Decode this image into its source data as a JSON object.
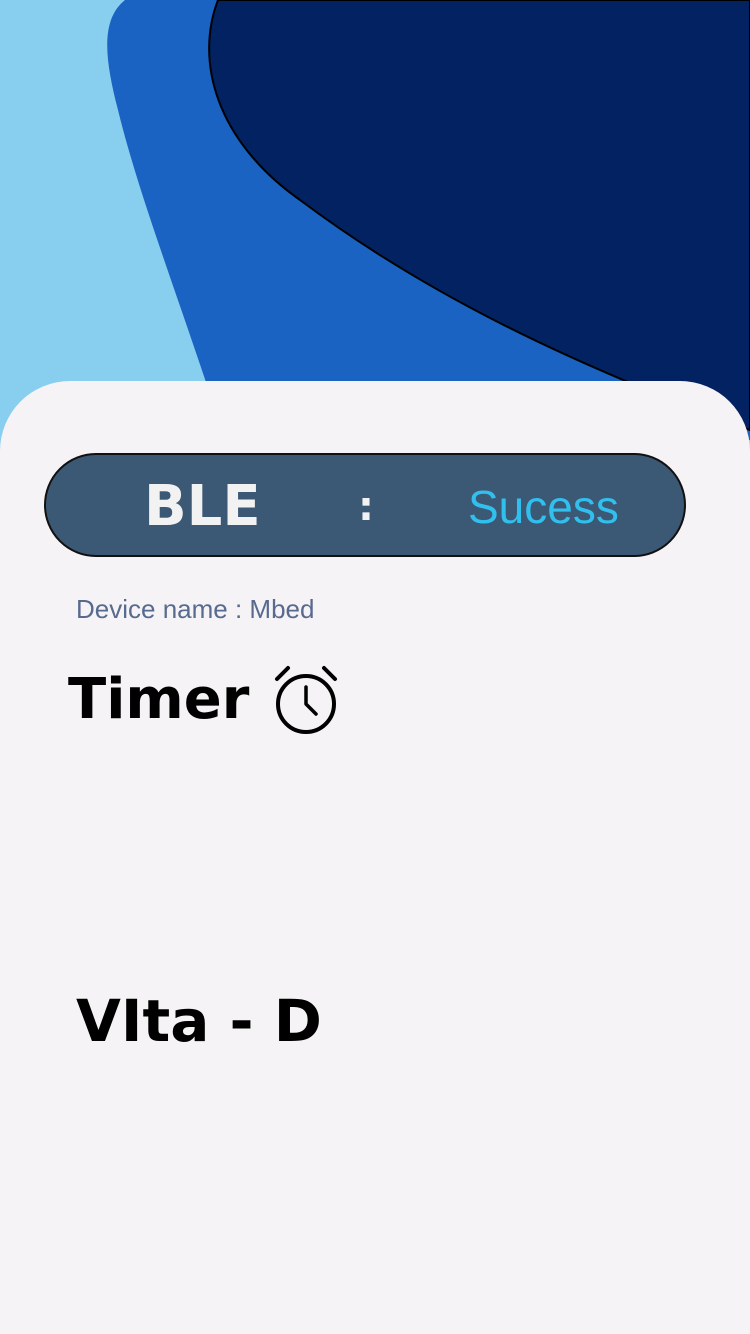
{
  "colors": {
    "background": "#F5F3F5",
    "wave_light": "#87CEEF",
    "wave_mid": "#1A63C2",
    "wave_dark": "#032262",
    "pill_background": "#3B5875",
    "pill_text": "#F2F2F2",
    "status_success": "#31C0EE",
    "device_text": "#586B8F",
    "heading_text": "#000000"
  },
  "ble_status": {
    "label": "BLE",
    "separator": ":",
    "value": "Sucess"
  },
  "device": {
    "text": "Device name : Mbed"
  },
  "timer": {
    "title": "Timer",
    "icon": "alarm-clock-icon"
  },
  "vita": {
    "title": "VIta - D"
  }
}
